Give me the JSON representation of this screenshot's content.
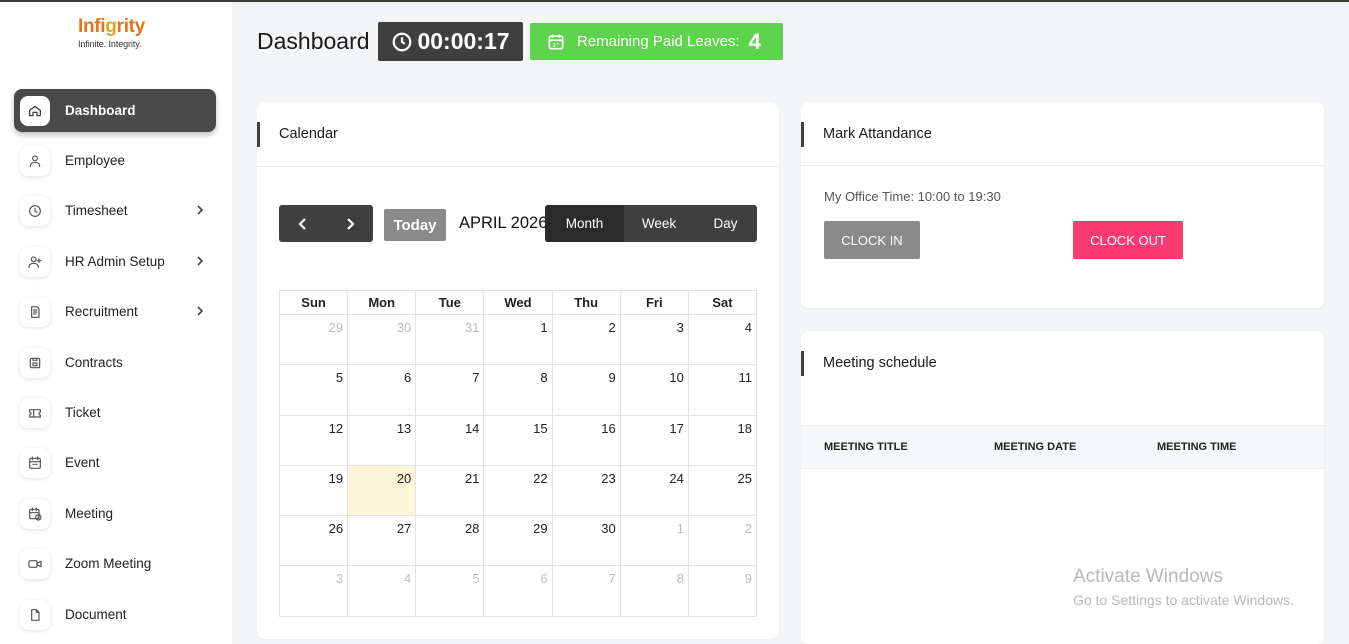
{
  "brand": {
    "name_pre": "Infi",
    "name_o": "g",
    "name_post": "rity",
    "tagline": "Infinite. Integrity."
  },
  "sidebar": {
    "items": [
      {
        "label": "Dashboard",
        "icon": "home-icon",
        "active": true
      },
      {
        "label": "Employee",
        "icon": "user-icon"
      },
      {
        "label": "Timesheet",
        "icon": "clock-icon",
        "submenu": true
      },
      {
        "label": "HR Admin Setup",
        "icon": "user-plus-icon",
        "submenu": true
      },
      {
        "label": "Recruitment",
        "icon": "document-icon",
        "submenu": true
      },
      {
        "label": "Contracts",
        "icon": "save-icon"
      },
      {
        "label": "Ticket",
        "icon": "ticket-icon"
      },
      {
        "label": "Event",
        "icon": "calendar-icon"
      },
      {
        "label": "Meeting",
        "icon": "calendar-clock-icon"
      },
      {
        "label": "Zoom Meeting",
        "icon": "video-icon"
      },
      {
        "label": "Document",
        "icon": "file-icon"
      }
    ]
  },
  "header": {
    "title": "Dashboard",
    "timer": "00:00:17",
    "leaves_label": "Remaining Paid Leaves:",
    "leaves_count": "4"
  },
  "calendar": {
    "title": "Calendar",
    "today_label": "Today",
    "month_label": "APRIL 2026",
    "views": [
      "Month",
      "Week",
      "Day"
    ],
    "selected_view": "Month",
    "weekdays": [
      "Sun",
      "Mon",
      "Tue",
      "Wed",
      "Thu",
      "Fri",
      "Sat"
    ],
    "weeks": [
      [
        {
          "d": "29",
          "m": true
        },
        {
          "d": "30",
          "m": true
        },
        {
          "d": "31",
          "m": true
        },
        {
          "d": "1"
        },
        {
          "d": "2"
        },
        {
          "d": "3"
        },
        {
          "d": "4"
        }
      ],
      [
        {
          "d": "5"
        },
        {
          "d": "6"
        },
        {
          "d": "7"
        },
        {
          "d": "8"
        },
        {
          "d": "9"
        },
        {
          "d": "10"
        },
        {
          "d": "11"
        }
      ],
      [
        {
          "d": "12"
        },
        {
          "d": "13"
        },
        {
          "d": "14"
        },
        {
          "d": "15"
        },
        {
          "d": "16"
        },
        {
          "d": "17"
        },
        {
          "d": "18"
        }
      ],
      [
        {
          "d": "19"
        },
        {
          "d": "20",
          "t": true
        },
        {
          "d": "21"
        },
        {
          "d": "22"
        },
        {
          "d": "23"
        },
        {
          "d": "24"
        },
        {
          "d": "25"
        }
      ],
      [
        {
          "d": "26"
        },
        {
          "d": "27"
        },
        {
          "d": "28"
        },
        {
          "d": "29"
        },
        {
          "d": "30"
        },
        {
          "d": "1",
          "m": true
        },
        {
          "d": "2",
          "m": true
        }
      ],
      [
        {
          "d": "3",
          "m": true
        },
        {
          "d": "4",
          "m": true
        },
        {
          "d": "5",
          "m": true
        },
        {
          "d": "6",
          "m": true
        },
        {
          "d": "7",
          "m": true
        },
        {
          "d": "8",
          "m": true
        },
        {
          "d": "9",
          "m": true
        }
      ]
    ]
  },
  "attendance": {
    "title": "Mark Attandance",
    "office_time": "My Office Time: 10:00 to 19:30",
    "clock_in": "CLOCK IN",
    "clock_out": "CLOCK OUT"
  },
  "meeting": {
    "title": "Meeting schedule",
    "columns": [
      "MEETING TITLE",
      "MEETING DATE",
      "MEETING TIME"
    ]
  },
  "watermark": {
    "line1": "Activate Windows",
    "line2": "Go to Settings to activate Windows."
  },
  "colors": {
    "accent_dark": "#3f3f3f",
    "leaves_green": "#5ed44e",
    "clock_out_pink": "#fc3a72",
    "today_highlight": "#fdf6d9"
  }
}
